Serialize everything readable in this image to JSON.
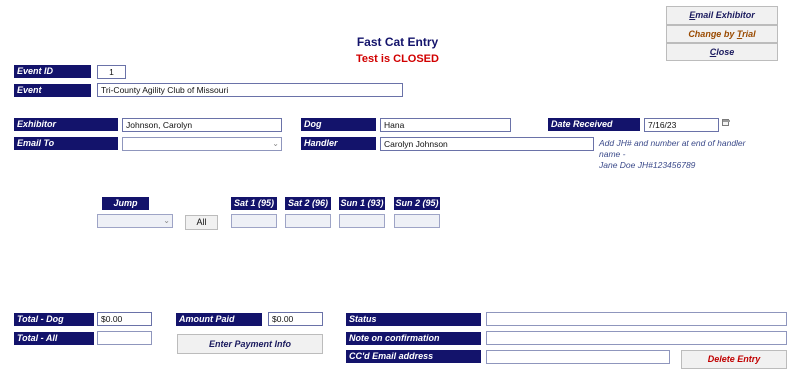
{
  "header": {
    "title": "Fast Cat Entry",
    "status": "Test is CLOSED"
  },
  "top_buttons": {
    "email_exhibitor": {
      "prefix": "E",
      "rest": "mail Exhibitor"
    },
    "change_by_trial": {
      "prefix": "Change by ",
      "underline": "T",
      "rest": "rial"
    },
    "close": {
      "prefix": "",
      "underline": "C",
      "rest": "lose"
    }
  },
  "event": {
    "id_label": "Event ID",
    "id_value": "1",
    "event_label": "Event",
    "event_value": "Tri-County Agility Club of Missouri"
  },
  "exhibitor": {
    "label": "Exhibitor",
    "value": "Johnson, Carolyn",
    "email_label": "Email To",
    "email_value": ""
  },
  "dog": {
    "label": "Dog",
    "value": "Hana",
    "handler_label": "Handler",
    "handler_value": "Carolyn Johnson"
  },
  "date": {
    "label": "Date Received",
    "value": "7/16/23"
  },
  "handler_hint": [
    "Add JH# and number at end of handler",
    "name -",
    "Jane Doe JH#123456789"
  ],
  "classes": {
    "jump_label": "Jump",
    "jump_value": "",
    "all_button": "All",
    "trials": [
      {
        "label": "Sat 1 (95)",
        "value": ""
      },
      {
        "label": "Sat 2 (96)",
        "value": ""
      },
      {
        "label": "Sun 1 (93)",
        "value": ""
      },
      {
        "label": "Sun 2 (95)",
        "value": ""
      }
    ]
  },
  "totals": {
    "dog_label": "Total - Dog",
    "dog_value": "$0.00",
    "all_label": "Total - All",
    "all_value": "",
    "paid_label": "Amount Paid",
    "paid_value": "$0.00",
    "payment_button": "Enter Payment Info"
  },
  "notes": {
    "status_label": "Status",
    "status_value": "",
    "note_label": "Note on confirmation",
    "note_value": "",
    "cc_label": "CC'd Email address",
    "cc_value": ""
  },
  "delete_button": "Delete Entry",
  "colors": {
    "label_bg": "#13136b",
    "title": "#13136b",
    "closed": "#d10000",
    "delete": "#c00000",
    "trial_btn": "#9a4a00"
  }
}
